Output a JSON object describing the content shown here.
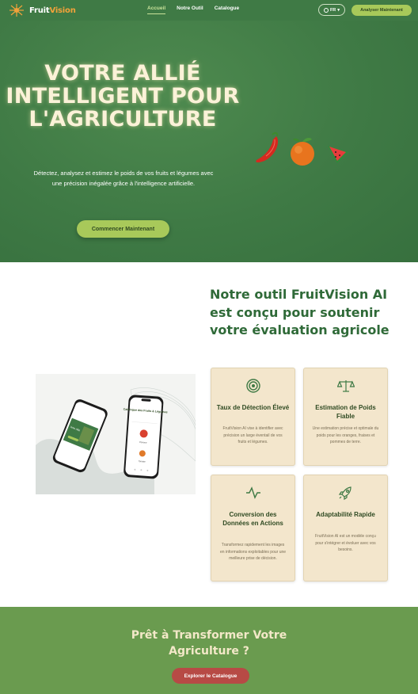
{
  "brand": {
    "name_part1": "Fruit",
    "name_part2": "Vision"
  },
  "nav": {
    "links": [
      "Accueil",
      "Notre Outil",
      "Catalogue"
    ],
    "language": "FR",
    "cta": "Analyser Maintenant"
  },
  "hero": {
    "title": "VOTRE ALLIÉ INTELLIGENT POUR L'AGRICULTURE",
    "subtitle": "Détectez, analysez et estimez le poids de vos fruits et légumes avec une précision inégalée grâce à l'intelligence artificielle.",
    "button": "Commencer Maintenant"
  },
  "features": {
    "title": "Notre outil FruitVision AI est conçu pour soutenir votre évaluation agricole",
    "phone_screen": {
      "heading": "Catalogue des Fruits & Légumes",
      "item1": "Pomme",
      "item2": "Tomate"
    },
    "cards": [
      {
        "title": "Taux de Détection Élevé",
        "desc": "FruitVision AI vise à identifier avec précision un large éventail de vos fruits et légumes.",
        "icon": "target-icon"
      },
      {
        "title": "Estimation de Poids Fiable",
        "desc": "Une estimation précise et optimale du poids pour les oranges, fraises et pommes de terre.",
        "icon": "scale-icon"
      },
      {
        "title": "Conversion des Données en Actions",
        "desc": "Transformez rapidement les images en informations exploitables pour une meilleure prise de décision.",
        "icon": "activity-icon"
      },
      {
        "title": "Adaptabilité Rapide",
        "desc": "FruitVision AI est un modèle conçu pour s'intégrer et évoluer avec vos besoins.",
        "icon": "rocket-icon"
      }
    ]
  },
  "cta_section": {
    "title": "Prêt à Transformer Votre Agriculture ?",
    "button": "Explorer le Catalogue"
  },
  "colors": {
    "primary_green": "#3f7a45",
    "light_green": "#a8c95a",
    "cream": "#f3e6cc",
    "title_green": "#2f6a38",
    "cta_red": "#b74a45"
  }
}
